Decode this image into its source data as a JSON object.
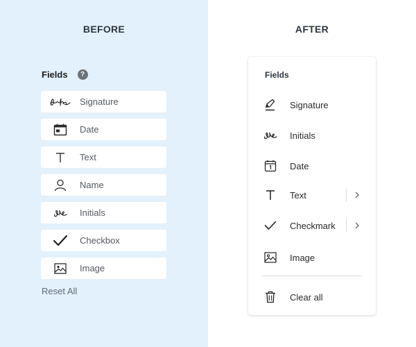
{
  "before": {
    "heading": "BEFORE",
    "fields_title": "Fields",
    "help_icon": "?",
    "items": [
      {
        "label": "Signature",
        "icon": "signature-icon"
      },
      {
        "label": "Date",
        "icon": "calendar-icon"
      },
      {
        "label": "Text",
        "icon": "text-icon"
      },
      {
        "label": "Name",
        "icon": "person-icon"
      },
      {
        "label": "Initials",
        "icon": "initials-icon"
      },
      {
        "label": "Checkbox",
        "icon": "checkmark-icon"
      },
      {
        "label": "Image",
        "icon": "image-icon"
      }
    ],
    "reset_label": "Reset All"
  },
  "after": {
    "heading": "AFTER",
    "fields_title": "Fields",
    "items": [
      {
        "label": "Signature",
        "icon": "pen-icon"
      },
      {
        "label": "Initials",
        "icon": "initials-icon"
      },
      {
        "label": "Date",
        "icon": "calendar-icon"
      },
      {
        "label": "Text",
        "icon": "text-icon",
        "submenu": true
      },
      {
        "label": "Checkmark",
        "icon": "checkmark-icon",
        "submenu": true
      },
      {
        "label": "Image",
        "icon": "image-icon"
      }
    ],
    "clear_label": "Clear all"
  },
  "colors": {
    "before_bg": "#e3f1fc",
    "after_bg": "#ffffff",
    "help_icon_bg": "#6d7278"
  }
}
